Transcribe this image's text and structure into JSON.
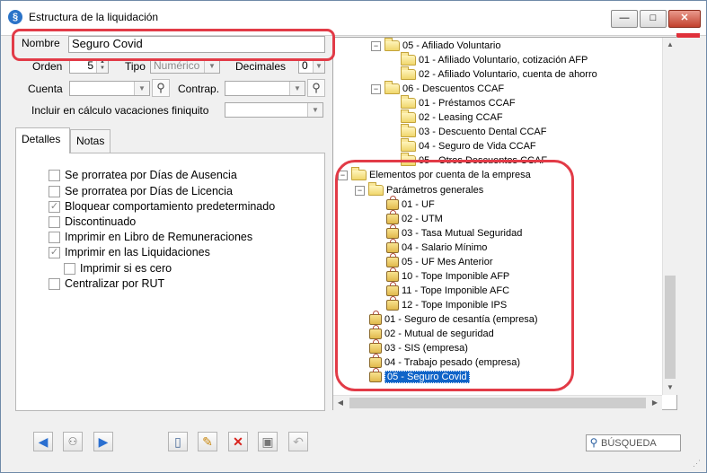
{
  "window": {
    "title": "Estructura de la liquidación"
  },
  "form": {
    "nombre_label": "Nombre",
    "nombre_value": "Seguro Covid",
    "orden_label": "Orden",
    "orden_value": "5",
    "tipo_label": "Tipo",
    "tipo_value": "Numérico",
    "decimales_label": "Decimales",
    "decimales_value": "0",
    "cuenta_label": "Cuenta",
    "cuenta_value": "",
    "contrap_label": "Contrap.",
    "contrap_value": "",
    "vacaciones_label": "Incluir en cálculo vacaciones finiquito",
    "vacaciones_value": ""
  },
  "tabs": [
    {
      "label": "Detalles"
    },
    {
      "label": "Notas"
    }
  ],
  "checkboxes": [
    {
      "label": "Se prorratea por Días de Ausencia",
      "checked": false
    },
    {
      "label": "Se prorratea por Días de Licencia",
      "checked": false
    },
    {
      "label": "Bloquear comportamiento predeterminado",
      "checked": true
    },
    {
      "label": "Discontinuado",
      "checked": false
    },
    {
      "label": "Imprimir en Libro de Remuneraciones",
      "checked": false
    },
    {
      "label": "Imprimir en las Liquidaciones",
      "checked": true
    },
    {
      "label": "Imprimir si es cero",
      "checked": false
    },
    {
      "label": "Centralizar por RUT",
      "checked": false
    }
  ],
  "tree": {
    "nodes": [
      {
        "label": "05 - Afiliado Voluntario",
        "icon": "folder-icon",
        "expander": "−"
      },
      {
        "label": "01 - Afiliado Voluntario, cotización AFP",
        "icon": "folder-icon"
      },
      {
        "label": "02 - Afiliado Voluntario, cuenta de ahorro",
        "icon": "folder-icon"
      },
      {
        "label": "06 - Descuentos CCAF",
        "icon": "folder-icon",
        "expander": "−"
      },
      {
        "label": "01 - Préstamos CCAF",
        "icon": "folder-icon"
      },
      {
        "label": "02 - Leasing CCAF",
        "icon": "folder-icon"
      },
      {
        "label": "03 - Descuento Dental CCAF",
        "icon": "folder-icon"
      },
      {
        "label": "04 - Seguro de Vida CCAF",
        "icon": "folder-icon"
      },
      {
        "label": "05 - Otros Descuentos CCAF",
        "icon": "folder-icon"
      },
      {
        "label": "Elementos por cuenta de la empresa",
        "icon": "folder-icon",
        "expander": "−"
      },
      {
        "label": "Parámetros generales",
        "icon": "folder-icon",
        "expander": "−"
      },
      {
        "label": "01 - UF",
        "icon": "lock-icon"
      },
      {
        "label": "02 - UTM",
        "icon": "lock-icon"
      },
      {
        "label": "03 - Tasa Mutual Seguridad",
        "icon": "lock-icon"
      },
      {
        "label": "04 - Salario Mínimo",
        "icon": "lock-icon"
      },
      {
        "label": "05 - UF Mes Anterior",
        "icon": "lock-icon"
      },
      {
        "label": "10 - Tope Imponible AFP",
        "icon": "lock-icon"
      },
      {
        "label": "11 - Tope Imponible AFC",
        "icon": "lock-icon"
      },
      {
        "label": "12 - Tope Imponible IPS",
        "icon": "lock-icon"
      },
      {
        "label": "01 - Seguro de cesantía (empresa)",
        "icon": "lock-icon"
      },
      {
        "label": "02 - Mutual de seguridad",
        "icon": "lock-icon"
      },
      {
        "label": "03 - SIS (empresa)",
        "icon": "lock-icon"
      },
      {
        "label": "04 - Trabajo pesado (empresa)",
        "icon": "lock-icon"
      },
      {
        "label": "05 - Seguro Covid",
        "icon": "lock-icon",
        "selected": true
      }
    ]
  },
  "footer": {
    "search_placeholder": "BÚSQUEDA"
  },
  "colors": {
    "highlight": "#e23b47",
    "selection": "#1064c8"
  }
}
